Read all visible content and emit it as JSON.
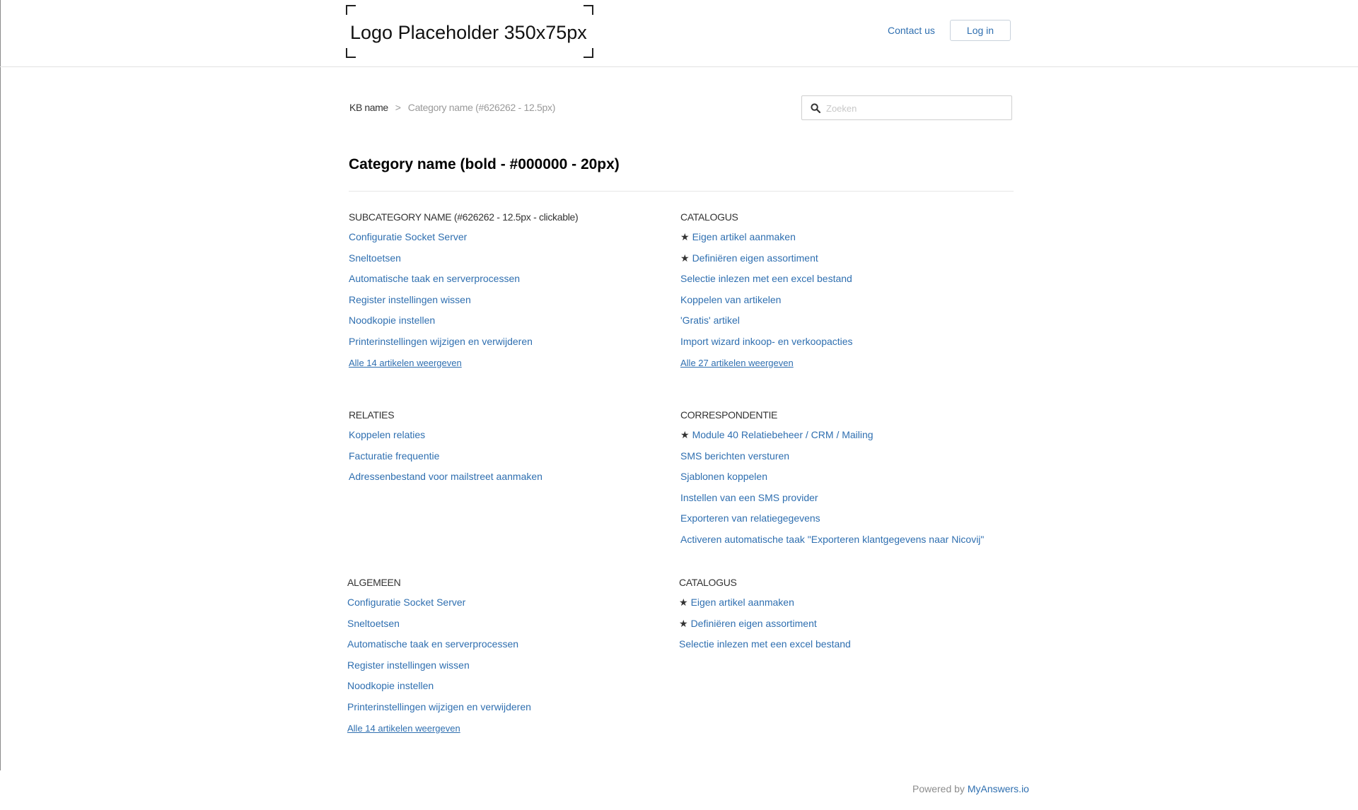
{
  "header": {
    "logo_text": "Logo Placeholder 350x75px",
    "contact_label": "Contact us",
    "login_label": "Log in"
  },
  "breadcrumb": {
    "root": "KB name",
    "separator": ">",
    "current": "Category name (#626262 - 12.5px)"
  },
  "search": {
    "placeholder": "Zoeken"
  },
  "page_title": "Category name (bold - #000000 - 20px)",
  "sections": [
    {
      "heading": "SUBCATEGORY NAME (#626262 - 12.5px - clickable)",
      "items": [
        {
          "label": "Configuratie Socket Server",
          "starred": false
        },
        {
          "label": "Sneltoetsen",
          "starred": false
        },
        {
          "label": "Automatische taak en serverprocessen",
          "starred": false
        },
        {
          "label": "Register instellingen wissen",
          "starred": false
        },
        {
          "label": "Noodkopie instellen",
          "starred": false
        },
        {
          "label": "Printerinstellingen wijzigen en verwijderen",
          "starred": false
        }
      ],
      "all_link": "Alle 14 artikelen weergeven"
    },
    {
      "heading": "CATALOGUS",
      "items": [
        {
          "label": "Eigen artikel aanmaken",
          "starred": true
        },
        {
          "label": "Definiëren eigen assortiment",
          "starred": true
        },
        {
          "label": "Selectie inlezen met een excel bestand",
          "starred": false
        },
        {
          "label": "Koppelen van artikelen",
          "starred": false
        },
        {
          "label": "'Gratis' artikel",
          "starred": false
        },
        {
          "label": "Import wizard inkoop- en verkoopacties",
          "starred": false
        }
      ],
      "all_link": "Alle 27 artikelen weergeven"
    },
    {
      "heading": "RELATIES",
      "items": [
        {
          "label": "Koppelen relaties",
          "starred": false
        },
        {
          "label": "Facturatie frequentie",
          "starred": false
        },
        {
          "label": "Adressenbestand voor mailstreet aanmaken",
          "starred": false
        }
      ],
      "all_link": ""
    },
    {
      "heading": "CORRESPONDENTIE",
      "items": [
        {
          "label": "Module 40 Relatiebeheer / CRM / Mailing",
          "starred": true
        },
        {
          "label": "SMS berichten versturen",
          "starred": false
        },
        {
          "label": "Sjablonen koppelen",
          "starred": false
        },
        {
          "label": "Instellen van een SMS provider",
          "starred": false
        },
        {
          "label": "Exporteren van relatiegegevens",
          "starred": false
        },
        {
          "label": "Activeren automatische taak \"Exporteren klantgegevens naar Nicovij\"",
          "starred": false
        }
      ],
      "all_link": ""
    },
    {
      "heading": "ALGEMEEN",
      "items": [
        {
          "label": "Configuratie Socket Server",
          "starred": false
        },
        {
          "label": "Sneltoetsen",
          "starred": false
        },
        {
          "label": "Automatische taak en serverprocessen",
          "starred": false
        },
        {
          "label": "Register instellingen wissen",
          "starred": false
        },
        {
          "label": "Noodkopie instellen",
          "starred": false
        },
        {
          "label": "Printerinstellingen wijzigen en verwijderen",
          "starred": false
        }
      ],
      "all_link": "Alle 14 artikelen weergeven"
    },
    {
      "heading": "CATALOGUS",
      "items": [
        {
          "label": "Eigen artikel aanmaken",
          "starred": true
        },
        {
          "label": "Definiëren eigen assortiment",
          "starred": true
        },
        {
          "label": "Selectie inlezen met een excel bestand",
          "starred": false
        }
      ],
      "all_link": ""
    }
  ],
  "footer": {
    "powered_by": "Powered by",
    "brand": "MyAnswers.io"
  },
  "colors": {
    "link": "#2f6fb0",
    "title": "#000000",
    "heading": "#333333",
    "muted": "#9a9a9a"
  },
  "icons": {
    "search": "magnifier-icon",
    "star": "star-icon"
  }
}
